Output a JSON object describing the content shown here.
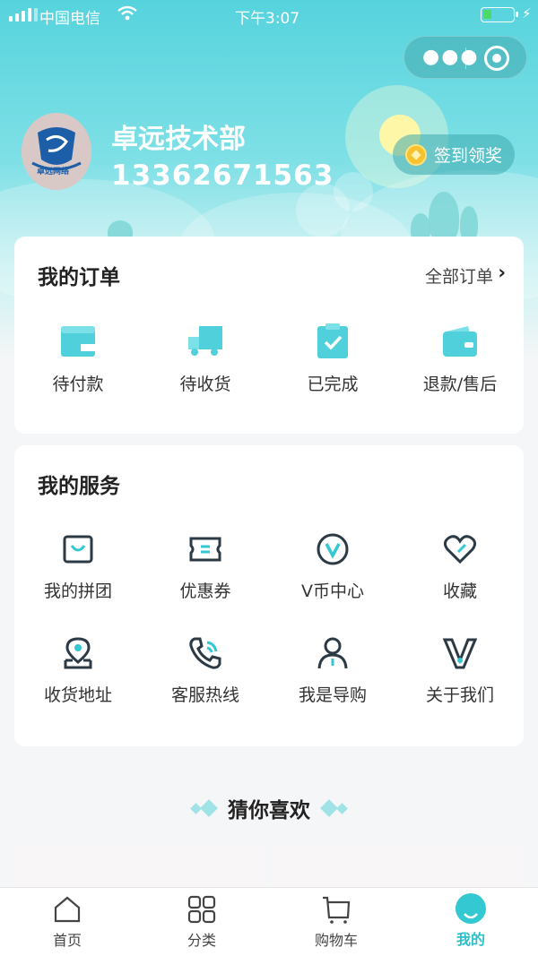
{
  "status_bar": {
    "carrier": "中国电信",
    "time": "下午3:07"
  },
  "profile": {
    "name": "卓远技术部",
    "phone": "13362671563",
    "avatar_text": "卓远网络",
    "checkin_label": "签到领奖"
  },
  "orders": {
    "title": "我的订单",
    "all_label": "全部订单",
    "items": [
      {
        "label": "待付款",
        "icon": "wallet-icon"
      },
      {
        "label": "待收货",
        "icon": "truck-icon"
      },
      {
        "label": "已完成",
        "icon": "clipboard-check-icon"
      },
      {
        "label": "退款/售后",
        "icon": "refund-wallet-icon"
      }
    ]
  },
  "services": {
    "title": "我的服务",
    "items": [
      {
        "label": "我的拼团",
        "icon": "shopping-bag-icon"
      },
      {
        "label": "优惠券",
        "icon": "coupon-icon"
      },
      {
        "label": "V币中心",
        "icon": "v-coin-icon"
      },
      {
        "label": "收藏",
        "icon": "heart-icon"
      },
      {
        "label": "收货地址",
        "icon": "location-pin-icon"
      },
      {
        "label": "客服热线",
        "icon": "phone-call-icon"
      },
      {
        "label": "我是导购",
        "icon": "person-icon"
      },
      {
        "label": "关于我们",
        "icon": "v-logo-icon"
      }
    ]
  },
  "recommend": {
    "title": "猜你喜欢"
  },
  "tabbar": {
    "items": [
      {
        "label": "首页",
        "icon": "home-icon"
      },
      {
        "label": "分类",
        "icon": "category-grid-icon"
      },
      {
        "label": "购物车",
        "icon": "cart-icon"
      },
      {
        "label": "我的",
        "icon": "profile-icon",
        "active": true
      }
    ]
  },
  "colors": {
    "accent": "#33c8d2",
    "hero_top": "#56d3dd",
    "icon_dark": "#2b3a44"
  }
}
